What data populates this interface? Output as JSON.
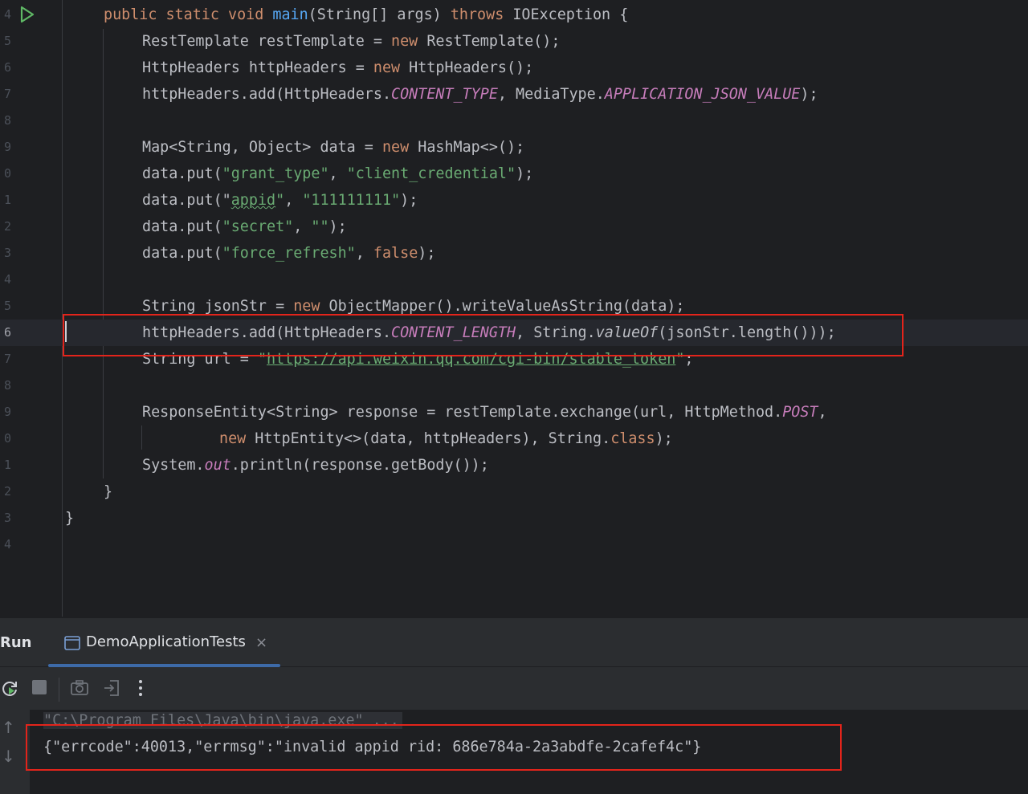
{
  "editor": {
    "lines": [
      {
        "num": "4"
      },
      {
        "num": "5"
      },
      {
        "num": "6"
      },
      {
        "num": "7"
      },
      {
        "num": "8"
      },
      {
        "num": "9"
      },
      {
        "num": "0"
      },
      {
        "num": "1"
      },
      {
        "num": "2"
      },
      {
        "num": "3"
      },
      {
        "num": "4"
      },
      {
        "num": "5"
      },
      {
        "num": "6"
      },
      {
        "num": "7"
      },
      {
        "num": "8"
      },
      {
        "num": "9"
      },
      {
        "num": "0"
      },
      {
        "num": "1"
      },
      {
        "num": "2"
      },
      {
        "num": "3"
      },
      {
        "num": "4"
      }
    ],
    "code": {
      "l4": [
        "public static void ",
        "main",
        "(String[] args) ",
        "throws",
        " IOException {"
      ],
      "l5": [
        "RestTemplate restTemplate = ",
        "new",
        " RestTemplate();"
      ],
      "l6": [
        "HttpHeaders httpHeaders = ",
        "new",
        " HttpHeaders();"
      ],
      "l7": [
        "httpHeaders.add(HttpHeaders.",
        "CONTENT_TYPE",
        ", MediaType.",
        "APPLICATION_JSON_VALUE",
        ");"
      ],
      "l9": [
        "Map<String, Object> data = ",
        "new",
        " HashMap<>();"
      ],
      "l10": [
        "data.put(",
        "\"grant_type\"",
        ", ",
        "\"client_credential\"",
        ");"
      ],
      "l11": [
        "data.put(\"",
        "appid",
        "\"",
        ", ",
        "\"111111111\"",
        ");"
      ],
      "l12": [
        "data.put(",
        "\"secret\"",
        ", ",
        "\"\"",
        ");"
      ],
      "l13": [
        "data.put(",
        "\"force_refresh\"",
        ", ",
        "false",
        ");"
      ],
      "l15": [
        "String jsonStr = ",
        "new",
        " ObjectMapper().writeValueAsString(data);"
      ],
      "l16": [
        "httpHeaders.add(HttpHeaders.",
        "CONTENT_LENGTH",
        ", String.",
        "valueOf",
        "(jsonStr.length()));"
      ],
      "l17": [
        "String url = ",
        "\"",
        "https://api.weixin.qq.com/cgi-bin/stable_token",
        "\"",
        ";"
      ],
      "l19": [
        "ResponseEntity<String> response = restTemplate.exchange(url, HttpMethod.",
        "POST",
        ","
      ],
      "l20": [
        "new",
        " HttpEntity<>(data, httpHeaders), String.",
        "class",
        ");"
      ],
      "l21": [
        "System.",
        "out",
        ".println(response.getBody());"
      ],
      "l22": [
        "}"
      ],
      "l23": [
        "}"
      ]
    }
  },
  "run_panel": {
    "label": "Run",
    "tab_label": "DemoApplicationTests",
    "tab_close": "×",
    "toolbar": [
      "rerun-icon",
      "stop-icon",
      "camera-icon",
      "exit-icon",
      "more-icon"
    ],
    "console": {
      "command": "\"C:\\Program Files\\Java\\bin\\java.exe\" ...",
      "output": "{\"errcode\":40013,\"errmsg\":\"invalid appid rid: 686e784a-2a3abdfe-2cafef4c\"}",
      "up_arrow": "↑",
      "down_arrow": "↓"
    }
  },
  "colors": {
    "background": "#1e1f22",
    "keyword": "#cf8e6d",
    "string": "#6aab73",
    "constant": "#c77dbb",
    "function": "#56a8f5",
    "highlight_box": "#e3241b"
  }
}
